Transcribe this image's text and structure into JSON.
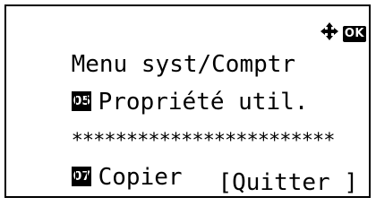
{
  "header": {
    "title": "Menu syst/Comptr",
    "nav_icon": "four-way-arrow-icon",
    "ok_label": "OK"
  },
  "menu": {
    "items": [
      {
        "number": "05",
        "label": "Propriété util."
      },
      {
        "masked": "************************"
      },
      {
        "number": "07",
        "label": "Copier"
      }
    ]
  },
  "softkey": {
    "label": "[Quitter ]"
  }
}
